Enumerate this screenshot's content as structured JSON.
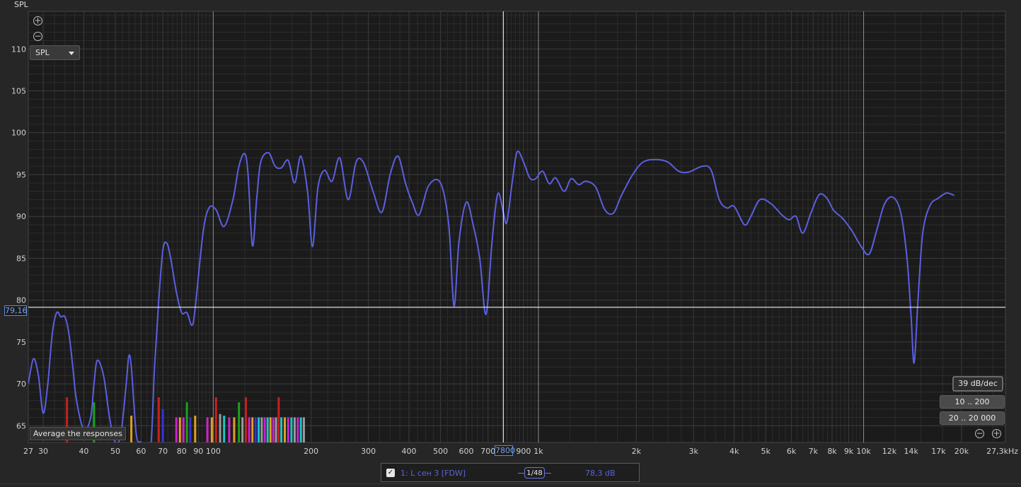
{
  "app": {
    "y_axis_title": "SPL",
    "measurement_dropdown": "SPL",
    "cursor_y_value": "79,16",
    "cursor_x_value": "7800",
    "tooltip": "Average the responses",
    "buttons": {
      "slope": "39 dB/dec",
      "range_low": "10 .. 200",
      "range_full": "20 .. 20 000"
    },
    "zoom_in_glyph": "+",
    "zoom_out_glyph": "−",
    "legend": {
      "checkbox": "✓",
      "name": "1: L сен 3 [FDW]",
      "smoothing": "1/48",
      "value": "78,3 dB"
    },
    "colors": {
      "background": "#1b1b1b",
      "grid_major": "#3c3c3c",
      "grid_minor": "#2c2c2c",
      "trace": "#5b5fe0",
      "cursor": "#ffffff"
    },
    "icons": [
      "zoom-in-icon",
      "zoom-out-icon",
      "dropdown-caret-icon",
      "checkbox-icon"
    ]
  },
  "chart_data": {
    "type": "line",
    "x_scale": "log",
    "xlim": [
      27,
      27300
    ],
    "ylim": [
      63,
      114.5
    ],
    "y_ticks": [
      65,
      70,
      75,
      80,
      85,
      90,
      95,
      100,
      105,
      110
    ],
    "x_ticks": [
      {
        "v": 27,
        "label": "27"
      },
      {
        "v": 30,
        "label": "30"
      },
      {
        "v": 40,
        "label": "40"
      },
      {
        "v": 50,
        "label": "50"
      },
      {
        "v": 60,
        "label": "60"
      },
      {
        "v": 70,
        "label": "70"
      },
      {
        "v": 80,
        "label": "80"
      },
      {
        "v": 90,
        "label": "90"
      },
      {
        "v": 100,
        "label": "100"
      },
      {
        "v": 200,
        "label": "200"
      },
      {
        "v": 300,
        "label": "300"
      },
      {
        "v": 400,
        "label": "400"
      },
      {
        "v": 500,
        "label": "500"
      },
      {
        "v": 600,
        "label": "600"
      },
      {
        "v": 700,
        "label": "700"
      },
      {
        "v": 900,
        "label": "900"
      },
      {
        "v": 1000,
        "label": "1k"
      },
      {
        "v": 2000,
        "label": "2k"
      },
      {
        "v": 3000,
        "label": "3k"
      },
      {
        "v": 4000,
        "label": "4k"
      },
      {
        "v": 5000,
        "label": "5k"
      },
      {
        "v": 6000,
        "label": "6k"
      },
      {
        "v": 7000,
        "label": "7k"
      },
      {
        "v": 8000,
        "label": "8k"
      },
      {
        "v": 9000,
        "label": "9k"
      },
      {
        "v": 10000,
        "label": "10k"
      },
      {
        "v": 12000,
        "label": "12k"
      },
      {
        "v": 14000,
        "label": "14k"
      },
      {
        "v": 17000,
        "label": "17k"
      },
      {
        "v": 20000,
        "label": "20k"
      },
      {
        "v": 27300,
        "label": "27,3kHz"
      }
    ],
    "highlight_x_lines": [
      100,
      1000,
      10000
    ],
    "cursor": {
      "x": 780,
      "y": 79.16
    },
    "grid": true,
    "series": [
      {
        "points": [
          [
            27,
            70
          ],
          [
            28,
            73
          ],
          [
            29,
            71
          ],
          [
            30,
            66.5
          ],
          [
            31,
            70
          ],
          [
            32,
            76
          ],
          [
            33,
            78.5
          ],
          [
            34,
            78
          ],
          [
            35,
            78
          ],
          [
            36,
            76
          ],
          [
            37,
            72
          ],
          [
            38,
            68
          ],
          [
            40,
            64.5
          ],
          [
            42,
            66
          ],
          [
            43,
            70
          ],
          [
            44,
            72.8
          ],
          [
            46,
            71
          ],
          [
            48,
            66
          ],
          [
            50,
            63
          ],
          [
            52,
            64
          ],
          [
            54,
            70
          ],
          [
            55,
            73.3
          ],
          [
            56,
            72
          ],
          [
            58,
            64
          ],
          [
            60,
            63
          ],
          [
            64,
            62
          ],
          [
            66,
            72
          ],
          [
            68,
            80
          ],
          [
            70,
            86
          ],
          [
            72,
            86.8
          ],
          [
            74,
            85
          ],
          [
            77,
            81
          ],
          [
            80,
            78.5
          ],
          [
            83,
            78.5
          ],
          [
            86,
            77
          ],
          [
            88,
            79
          ],
          [
            93,
            88
          ],
          [
            97,
            91
          ],
          [
            102,
            90.8
          ],
          [
            108,
            88.8
          ],
          [
            115,
            92
          ],
          [
            120,
            96
          ],
          [
            125,
            97.5
          ],
          [
            128,
            95
          ],
          [
            132,
            86.5
          ],
          [
            136,
            92
          ],
          [
            140,
            96.5
          ],
          [
            148,
            97.6
          ],
          [
            155,
            96
          ],
          [
            162,
            95.8
          ],
          [
            170,
            96.7
          ],
          [
            178,
            94
          ],
          [
            186,
            97.2
          ],
          [
            195,
            93
          ],
          [
            202,
            86.4
          ],
          [
            210,
            93.5
          ],
          [
            220,
            95.5
          ],
          [
            232,
            94.2
          ],
          [
            245,
            97
          ],
          [
            260,
            92
          ],
          [
            275,
            96.5
          ],
          [
            290,
            96.4
          ],
          [
            310,
            93
          ],
          [
            330,
            90.5
          ],
          [
            350,
            95
          ],
          [
            370,
            97.2
          ],
          [
            390,
            94
          ],
          [
            410,
            91.6
          ],
          [
            430,
            90.2
          ],
          [
            460,
            93.7
          ],
          [
            500,
            94
          ],
          [
            530,
            89
          ],
          [
            550,
            79.3
          ],
          [
            570,
            87
          ],
          [
            600,
            91.7
          ],
          [
            630,
            89
          ],
          [
            660,
            85
          ],
          [
            690,
            78.3
          ],
          [
            720,
            87
          ],
          [
            750,
            92.7
          ],
          [
            780,
            90.5
          ],
          [
            800,
            89.3
          ],
          [
            830,
            94
          ],
          [
            860,
            97.7
          ],
          [
            900,
            96.5
          ],
          [
            940,
            94.6
          ],
          [
            980,
            94.5
          ],
          [
            1030,
            95.4
          ],
          [
            1080,
            93.9
          ],
          [
            1130,
            94.6
          ],
          [
            1200,
            93
          ],
          [
            1260,
            94.5
          ],
          [
            1330,
            93.8
          ],
          [
            1400,
            94.2
          ],
          [
            1500,
            93.5
          ],
          [
            1600,
            90.8
          ],
          [
            1700,
            90.4
          ],
          [
            1800,
            92.5
          ],
          [
            1950,
            95
          ],
          [
            2100,
            96.5
          ],
          [
            2300,
            96.8
          ],
          [
            2500,
            96.5
          ],
          [
            2700,
            95.4
          ],
          [
            2900,
            95.3
          ],
          [
            3200,
            96
          ],
          [
            3400,
            95.5
          ],
          [
            3600,
            92
          ],
          [
            3800,
            91
          ],
          [
            4000,
            91.2
          ],
          [
            4300,
            89
          ],
          [
            4500,
            90
          ],
          [
            4800,
            92
          ],
          [
            5200,
            91.5
          ],
          [
            5600,
            90.2
          ],
          [
            5900,
            89.6
          ],
          [
            6200,
            90
          ],
          [
            6500,
            88
          ],
          [
            6900,
            90.5
          ],
          [
            7300,
            92.6
          ],
          [
            7700,
            92.2
          ],
          [
            8100,
            90.7
          ],
          [
            8600,
            89.8
          ],
          [
            9200,
            88.3
          ],
          [
            9800,
            86.5
          ],
          [
            10400,
            85.5
          ],
          [
            11000,
            88.5
          ],
          [
            11600,
            91.5
          ],
          [
            12300,
            92.3
          ],
          [
            13000,
            90.5
          ],
          [
            13600,
            85
          ],
          [
            14000,
            78
          ],
          [
            14300,
            72.5
          ],
          [
            14700,
            80
          ],
          [
            15200,
            88
          ],
          [
            16000,
            91.3
          ],
          [
            17000,
            92.2
          ],
          [
            18000,
            92.8
          ],
          [
            19000,
            92.5
          ]
        ]
      }
    ],
    "bars": [
      {
        "x": 35.5,
        "h": 68.4,
        "color": "#c81f1f"
      },
      {
        "x": 43,
        "h": 67.8,
        "color": "#19a319"
      },
      {
        "x": 56,
        "h": 66.2,
        "color": "#e0a020"
      },
      {
        "x": 68,
        "h": 68.4,
        "color": "#c81f1f"
      },
      {
        "x": 70,
        "h": 67,
        "color": "#3434d8"
      },
      {
        "x": 77,
        "h": 66,
        "color": "#d020d0"
      },
      {
        "x": 79,
        "h": 66,
        "color": "#e0a020"
      },
      {
        "x": 81,
        "h": 66,
        "color": "#d020d0"
      },
      {
        "x": 83,
        "h": 67.8,
        "color": "#19a319"
      },
      {
        "x": 85,
        "h": 66,
        "color": "#3434d8"
      },
      {
        "x": 88,
        "h": 66.2,
        "color": "#e0a020"
      },
      {
        "x": 96,
        "h": 66,
        "color": "#d020d0"
      },
      {
        "x": 99,
        "h": 66,
        "color": "#e0a020"
      },
      {
        "x": 102,
        "h": 68.4,
        "color": "#c81f1f"
      },
      {
        "x": 105,
        "h": 66.4,
        "color": "#9a9a9a"
      },
      {
        "x": 108,
        "h": 66.2,
        "color": "#19c8c8"
      },
      {
        "x": 112,
        "h": 66,
        "color": "#d020d0"
      },
      {
        "x": 116,
        "h": 66,
        "color": "#e0a020"
      },
      {
        "x": 120,
        "h": 67.8,
        "color": "#19a319"
      },
      {
        "x": 123,
        "h": 66,
        "color": "#9a9a9a"
      },
      {
        "x": 126,
        "h": 68.4,
        "color": "#c81f1f"
      },
      {
        "x": 129,
        "h": 66,
        "color": "#d020d0"
      },
      {
        "x": 132,
        "h": 66,
        "color": "#e0a020"
      },
      {
        "x": 135,
        "h": 66,
        "color": "#3434d8"
      },
      {
        "x": 138,
        "h": 66,
        "color": "#19c8c8"
      },
      {
        "x": 141,
        "h": 66,
        "color": "#9a9a9a"
      },
      {
        "x": 144,
        "h": 66,
        "color": "#d020d0"
      },
      {
        "x": 147,
        "h": 66,
        "color": "#19c8c8"
      },
      {
        "x": 150,
        "h": 66,
        "color": "#e0a020"
      },
      {
        "x": 153,
        "h": 66,
        "color": "#d020d0"
      },
      {
        "x": 156,
        "h": 66,
        "color": "#9a9a9a"
      },
      {
        "x": 159,
        "h": 68.4,
        "color": "#c81f1f"
      },
      {
        "x": 162,
        "h": 66,
        "color": "#19c8c8"
      },
      {
        "x": 166,
        "h": 66,
        "color": "#e0a020"
      },
      {
        "x": 170,
        "h": 66,
        "color": "#d020d0"
      },
      {
        "x": 174,
        "h": 66,
        "color": "#19c8c8"
      },
      {
        "x": 178,
        "h": 66,
        "color": "#9a9a9a"
      },
      {
        "x": 182,
        "h": 66,
        "color": "#d020d0"
      },
      {
        "x": 186,
        "h": 66,
        "color": "#19c8c8"
      },
      {
        "x": 190,
        "h": 66,
        "color": "#9a9a9a"
      }
    ]
  }
}
